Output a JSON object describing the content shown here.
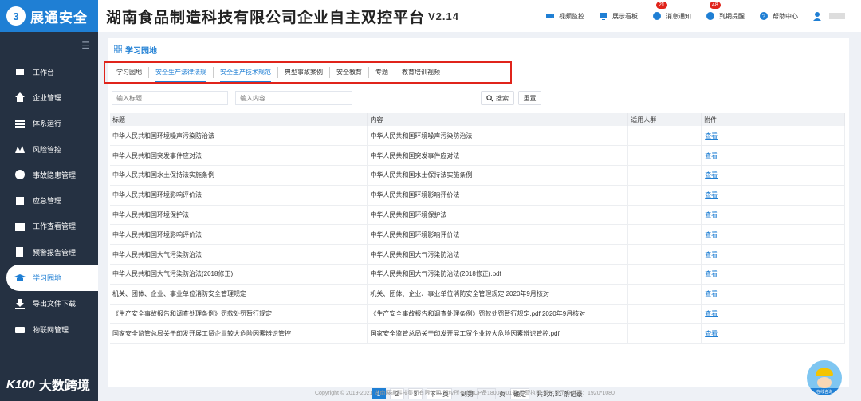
{
  "brand": {
    "name": "展通安全"
  },
  "header": {
    "title": "湖南食品制造科技有限公司企业自主双控平台",
    "version": "V2.14",
    "tools": [
      {
        "label": "视频监控",
        "icon": "camera-icon"
      },
      {
        "label": "展示看板",
        "icon": "dashboard-icon"
      },
      {
        "label": "消息通知",
        "icon": "message-icon",
        "badge": "21"
      },
      {
        "label": "到期提醒",
        "icon": "alarm-icon",
        "badge": "48"
      },
      {
        "label": "帮助中心",
        "icon": "help-icon"
      }
    ]
  },
  "sidebar": {
    "items": [
      {
        "label": "工作台",
        "icon": "workbench-icon"
      },
      {
        "label": "企业管理",
        "icon": "home-icon"
      },
      {
        "label": "体系运行",
        "icon": "system-icon"
      },
      {
        "label": "风险管控",
        "icon": "risk-icon"
      },
      {
        "label": "事故隐患管理",
        "icon": "hazard-icon"
      },
      {
        "label": "应急管理",
        "icon": "emergency-icon"
      },
      {
        "label": "工作查看管理",
        "icon": "calendar-icon"
      },
      {
        "label": "预警报告管理",
        "icon": "report-icon"
      },
      {
        "label": "学习园地",
        "icon": "graduation-icon",
        "active": true
      },
      {
        "label": "导出文件下载",
        "icon": "download-icon"
      },
      {
        "label": "物联网管理",
        "icon": "iot-icon"
      }
    ]
  },
  "breadcrumb": {
    "title": "学习园地"
  },
  "tabs": [
    {
      "label": "学习园地"
    },
    {
      "label": "安全生产法律法规",
      "active": true
    },
    {
      "label": "安全生产技术规范",
      "active": true
    },
    {
      "label": "典型事故案例"
    },
    {
      "label": "安全教育"
    },
    {
      "label": "专题"
    },
    {
      "label": "教育培训视频"
    }
  ],
  "search": {
    "title_placeholder": "输入标题",
    "content_placeholder": "输入内容",
    "search_label": "搜索",
    "reset_label": "重置"
  },
  "table": {
    "headers": [
      "标题",
      "内容",
      "适用人群",
      "附件"
    ],
    "rows": [
      {
        "title": "中华人民共和国环境噪声污染防治法",
        "content": "中华人民共和国环境噪声污染防治法",
        "audience": "",
        "attachment": "查看"
      },
      {
        "title": "中华人民共和国突发事件应对法",
        "content": "中华人民共和国突发事件应对法",
        "audience": "",
        "attachment": "查看"
      },
      {
        "title": "中华人民共和国水土保持法实施条例",
        "content": "中华人民共和国水土保持法实施条例",
        "audience": "",
        "attachment": "查看"
      },
      {
        "title": "中华人民共和国环境影响评价法",
        "content": "中华人民共和国环境影响评价法",
        "audience": "",
        "attachment": "查看"
      },
      {
        "title": "中华人民共和国环境保护法",
        "content": "中华人民共和国环境保护法",
        "audience": "",
        "attachment": "查看"
      },
      {
        "title": "中华人民共和国环境影响评价法",
        "content": "中华人民共和国环境影响评价法",
        "audience": "",
        "attachment": "查看"
      },
      {
        "title": "中华人民共和国大气污染防治法",
        "content": "中华人民共和国大气污染防治法",
        "audience": "",
        "attachment": "查看"
      },
      {
        "title": "中华人民共和国大气污染防治法(2018修正)",
        "content": "中华人民共和国大气污染防治法(2018修正).pdf",
        "audience": "",
        "attachment": "查看"
      },
      {
        "title": "机关、团体、企业、事业单位消防安全管理规定",
        "content": "机关、团体、企业、事业单位消防安全管理规定 2020年9月核对",
        "audience": "",
        "attachment": "查看"
      },
      {
        "title": "《生产安全事故报告和调查处理条例》罚款处罚暂行规定",
        "content": "《生产安全事故报告和调查处理条例》罚款处罚暂行规定.pdf 2020年9月核对",
        "audience": "",
        "attachment": "查看"
      },
      {
        "title": "国家安全监管总局关于印发开展工贸企业较大危险因素辨识管控",
        "content": "国家安全监管总局关于印发开展工贸企业较大危险因素辨识管控.pdf",
        "audience": "",
        "attachment": "查看"
      }
    ]
  },
  "pager": {
    "pages": [
      "1",
      "2",
      "3"
    ],
    "next_label": "下一页",
    "goto_prefix": "到第",
    "goto_suffix": "页",
    "confirm_label": "确定",
    "summary": "共3页,31 条记录"
  },
  "footer": {
    "text": "Copyright © 2019-2021 湖南展通科技集团有限公司 版权所有 湘ICP备18004301号 经营执照   最佳显示分辨率：1920*1080"
  },
  "watermark": {
    "logo": "K100",
    "text": "大数跨境"
  },
  "mascot": {
    "label": "在线咨询"
  },
  "colors": {
    "accent": "#1f7fd4",
    "sidebar": "#253142",
    "highlight_border": "#e0241b",
    "badge": "#e0241b"
  }
}
